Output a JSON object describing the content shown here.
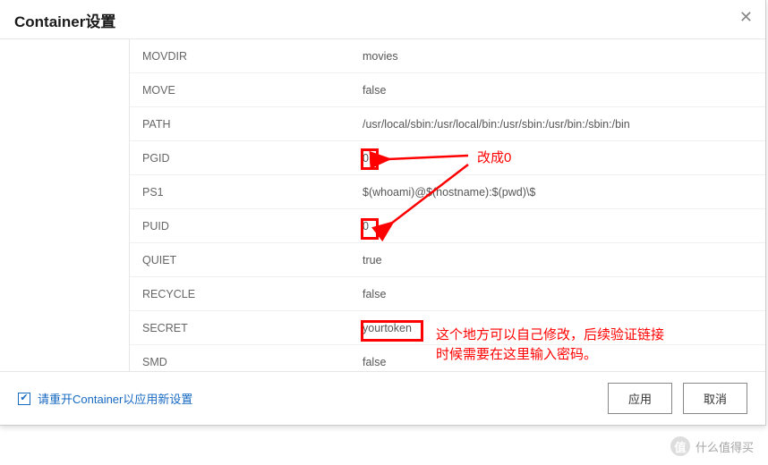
{
  "header": {
    "title": "Container设置"
  },
  "rows": [
    {
      "key": "MOVDIR",
      "val": "movies"
    },
    {
      "key": "MOVE",
      "val": "false"
    },
    {
      "key": "PATH",
      "val": "/usr/local/sbin:/usr/local/bin:/usr/sbin:/usr/bin:/sbin:/bin"
    },
    {
      "key": "PGID",
      "val": "0"
    },
    {
      "key": "PS1",
      "val": "$(whoami)@$(hostname):$(pwd)\\$"
    },
    {
      "key": "PUID",
      "val": "0"
    },
    {
      "key": "QUIET",
      "val": "true"
    },
    {
      "key": "RECYCLE",
      "val": "false"
    },
    {
      "key": "SECRET",
      "val": "yourtoken"
    },
    {
      "key": "SMD",
      "val": "false"
    }
  ],
  "footer": {
    "restart_label": "请重开Container以应用新设置",
    "apply": "应用",
    "cancel": "取消"
  },
  "annotations": {
    "change_to_zero": "改成0",
    "secret_note_l1": "这个地方可以自己修改，后续验证链接",
    "secret_note_l2": "时候需要在这里输入密码。"
  },
  "watermark": {
    "icon": "值",
    "text": "什么值得买"
  }
}
